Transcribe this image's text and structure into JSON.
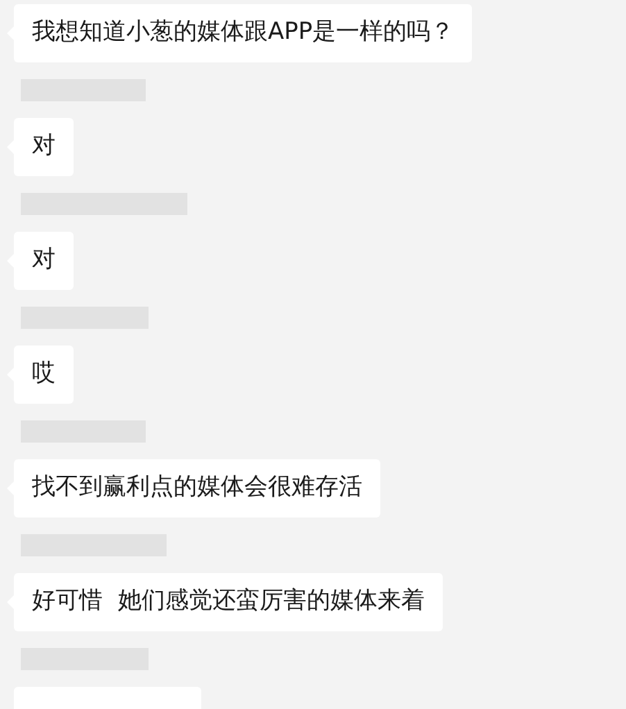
{
  "items": [
    {
      "kind": "message",
      "text": "我想知道小葱的媒体跟APP是一样的吗？"
    },
    {
      "kind": "redacted_name"
    },
    {
      "kind": "message",
      "text": "对"
    },
    {
      "kind": "redacted_name"
    },
    {
      "kind": "message",
      "text": "对"
    },
    {
      "kind": "redacted_name"
    },
    {
      "kind": "message",
      "text": "哎"
    },
    {
      "kind": "redacted_name"
    },
    {
      "kind": "message",
      "text": "找不到赢利点的媒体会很难存活"
    },
    {
      "kind": "redacted_name"
    },
    {
      "kind": "message",
      "text": "好可惜  她们感觉还蛮厉害的媒体来着"
    },
    {
      "kind": "redacted_name"
    },
    {
      "kind": "partial_message"
    }
  ]
}
